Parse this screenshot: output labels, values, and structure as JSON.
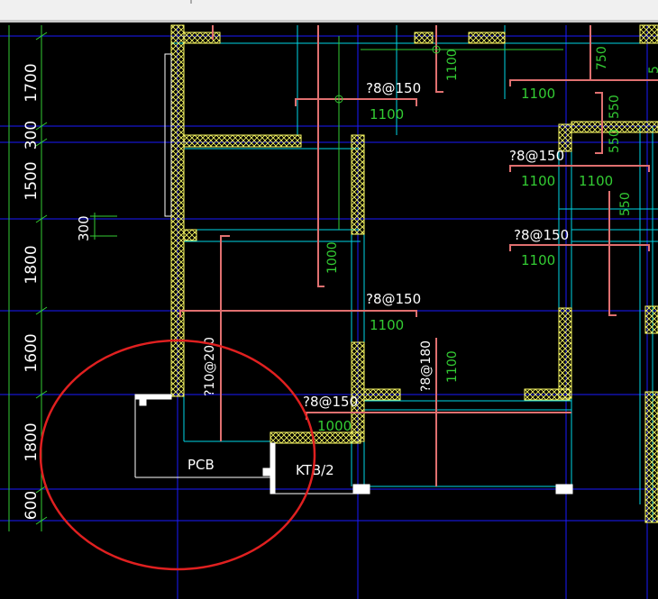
{
  "colors": {
    "background": "#000000",
    "grid": "#1a1aff",
    "cyan": "#00d6e6",
    "wall_hatch": "#ffff66",
    "rebar": "#e07070",
    "green_text": "#33cc33",
    "white_text": "#ffffff",
    "highlight_circle": "#e02020",
    "top_bar": "#f0f0f0"
  },
  "left_dimensions": [
    "1700",
    "300",
    "1500",
    "1800",
    "1600",
    "1800",
    "600"
  ],
  "side_label": "300",
  "rebar_labels": [
    {
      "spec": "?8@150",
      "length": "1100"
    },
    {
      "spec": "?8@150",
      "length": "1100"
    },
    {
      "spec": "?8@150",
      "length": "1100"
    },
    {
      "spec": "?8@150",
      "length": "1100"
    },
    {
      "spec": "?8@150",
      "length": "1000"
    }
  ],
  "second_lengths": [
    "1100",
    "1100"
  ],
  "vertical_labels": {
    "a": "?10@200",
    "b": "?8@180",
    "c": "1100",
    "d": "1000",
    "e": "1100",
    "f": "750",
    "g": "550",
    "h": "550",
    "i": "550",
    "j": "5"
  },
  "slab_labels": {
    "pcb": "PCB",
    "ktb": "KTB/2"
  }
}
